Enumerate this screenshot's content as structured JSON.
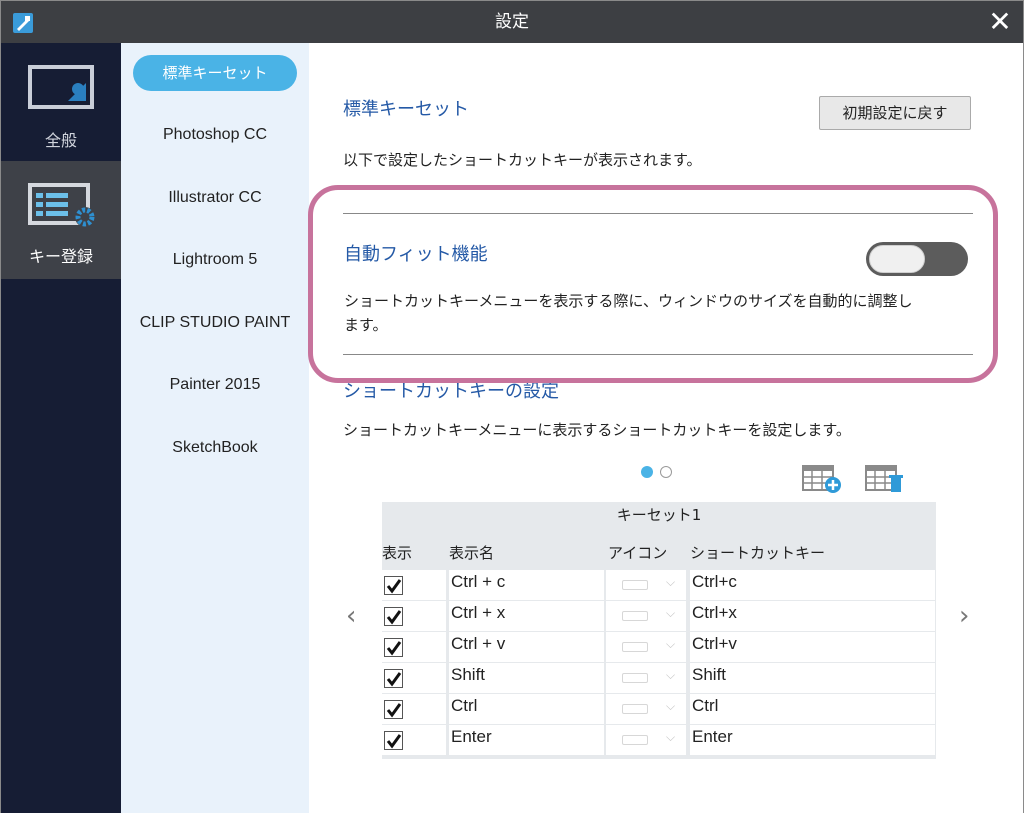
{
  "window": {
    "title": "設定",
    "close_glyph": "✕"
  },
  "nav": [
    {
      "label": "全般",
      "icon": "monitor-icon"
    },
    {
      "label": "キー登録",
      "icon": "key-settings-icon"
    }
  ],
  "keysets": {
    "active": "標準キーセット",
    "items": [
      "Photoshop CC",
      "Illustrator CC",
      "Lightroom 5",
      "CLIP STUDIO PAINT",
      "Painter 2015",
      "SketchBook"
    ]
  },
  "main": {
    "section1_title": "標準キーセット",
    "reset_button": "初期設定に戻す",
    "section1_desc": "以下で設定したショートカットキーが表示されます。",
    "autofit_title": "自動フィット機能",
    "autofit_desc_line1": "ショートカットキーメニューを表示する際に、ウィンドウのサイズを自動的に調整し",
    "autofit_desc_line2": "ます。",
    "autofit_enabled": false,
    "section2_title": "ショートカットキーの設定",
    "section2_desc": "ショートカットキーメニューに表示するショートカットキーを設定します。"
  },
  "pager": {
    "current": 1,
    "total": 2
  },
  "table": {
    "title": "キーセット1",
    "headers": {
      "show": "表示",
      "name": "表示名",
      "icon": "アイコン",
      "shortcut": "ショートカットキー"
    },
    "rows": [
      {
        "checked": true,
        "name": "Ctrl + c",
        "shortcut": "Ctrl+c"
      },
      {
        "checked": true,
        "name": "Ctrl + x",
        "shortcut": "Ctrl+x"
      },
      {
        "checked": true,
        "name": "Ctrl + v",
        "shortcut": "Ctrl+v"
      },
      {
        "checked": true,
        "name": "Shift",
        "shortcut": "Shift"
      },
      {
        "checked": true,
        "name": "Ctrl",
        "shortcut": "Ctrl"
      },
      {
        "checked": true,
        "name": "Enter",
        "shortcut": "Enter"
      }
    ]
  },
  "colors": {
    "accent": "#4ab3e6",
    "nav_bg": "#161d34",
    "title_blue": "#2459a6",
    "highlight": "#c7739c"
  }
}
